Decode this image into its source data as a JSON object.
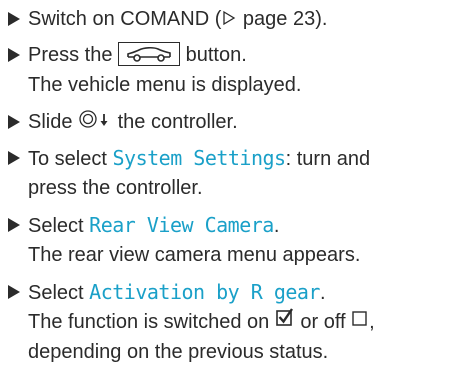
{
  "steps": [
    {
      "text_a": "Switch on COMAND (",
      "page_ref_icon": "triangle-right-outline-icon",
      "text_b": " page 23)."
    },
    {
      "text_a": "Press the ",
      "button_icon": "vehicle-car-icon",
      "text_b": " button.",
      "result": "The vehicle menu is displayed."
    },
    {
      "text_a": "Slide ",
      "controller_icon": "controller-slide-down-icon",
      "text_b": " the controller."
    },
    {
      "text_a": "To select ",
      "highlight": "System Settings",
      "text_b": ": turn and",
      "line2": "press the controller."
    },
    {
      "text_a": "Select ",
      "highlight": "Rear View Camera",
      "text_b": ".",
      "result": "The rear view camera menu appears."
    },
    {
      "text_a": "Select ",
      "highlight": "Activation by R gear",
      "text_b": ".",
      "result_a": "The function is switched on ",
      "checked_icon": "checkbox-checked-icon",
      "result_b": " or off ",
      "unchecked_icon": "checkbox-unchecked-icon",
      "result_c": ",",
      "result_line2": "depending on the previous status."
    }
  ],
  "colors": {
    "text": "#2b2b2b",
    "highlight": "#1aa0c8"
  }
}
